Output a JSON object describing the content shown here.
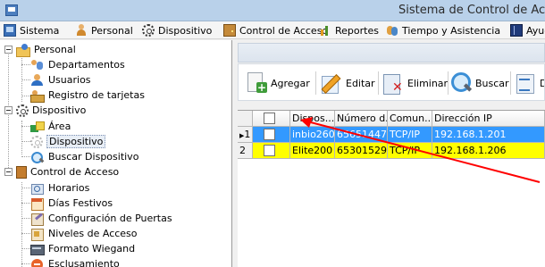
{
  "window": {
    "title": "Sistema de Control de Acce"
  },
  "menubar": {
    "items": [
      {
        "label": "Sistema",
        "icon": "monitor-icon"
      },
      {
        "label": "Personal",
        "icon": "person-icon"
      },
      {
        "label": "Dispositivo",
        "icon": "gear-icon"
      },
      {
        "label": "Control de Acceso",
        "icon": "door-icon"
      },
      {
        "label": "Reportes",
        "icon": "chart-icon"
      },
      {
        "label": "Tiempo y Asistencia",
        "icon": "people-icon"
      },
      {
        "label": "Ayud",
        "icon": "book-icon"
      }
    ]
  },
  "tree": {
    "personal": {
      "label": "Personal",
      "children": [
        "Departamentos",
        "Usuarios",
        "Registro de tarjetas"
      ]
    },
    "dispositivo": {
      "label": "Dispositivo",
      "children": [
        "Área",
        "Dispositivo",
        "Buscar Dispositivo"
      ],
      "selected": "Dispositivo"
    },
    "control_acceso": {
      "label": "Control de Acceso",
      "children": [
        "Horarios",
        "Días Festivos",
        "Configuración de Puertas",
        "Niveles de Acceso",
        "Formato Wiegand",
        "Esclusamiento"
      ]
    }
  },
  "toolbar": {
    "add_label": "Agregar",
    "edit_label": "Editar",
    "delete_label": "Eliminar",
    "search_label": "Buscar",
    "more_label": "D"
  },
  "grid": {
    "columns": [
      "Dispos...",
      "Número d...",
      "Comun...",
      "Dirección IP"
    ],
    "rows": [
      {
        "num": "1",
        "marker": "▶",
        "name": "inbio260",
        "serial": "65651447...",
        "comm": "TCP/IP",
        "ip": "192.168.1.201",
        "state": "selected"
      },
      {
        "num": "2",
        "marker": "",
        "name": "Elite200",
        "serial": "65301529...",
        "comm": "TCP/IP",
        "ip": "192.168.1.206",
        "state": "highlight"
      }
    ]
  },
  "colors": {
    "selection_blue": "#3399ff",
    "highlight_yellow": "#ffff00",
    "annotation_red": "#ff0000"
  }
}
